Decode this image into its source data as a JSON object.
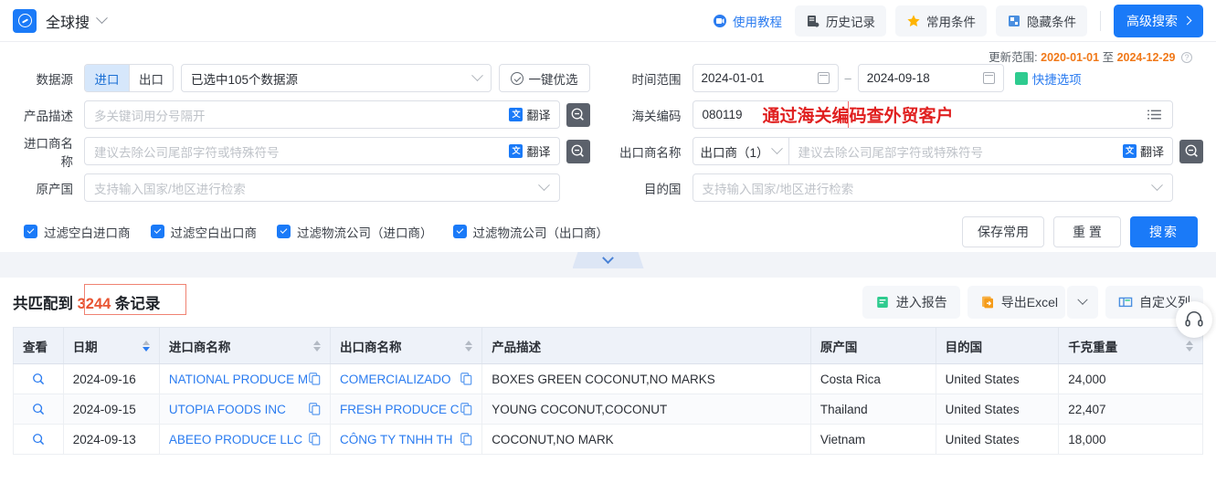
{
  "header": {
    "brand": "全球搜",
    "links": [
      {
        "label": "使用教程",
        "icon": "video-tutorial-icon",
        "style": "link"
      },
      {
        "label": "历史记录",
        "icon": "history-icon",
        "style": "chip"
      },
      {
        "label": "常用条件",
        "icon": "star-icon",
        "style": "chip"
      },
      {
        "label": "隐藏条件",
        "icon": "hide-icon",
        "style": "chip"
      }
    ],
    "advanced_button": "高级搜索"
  },
  "update_range": {
    "prefix": "更新范围:",
    "start": "2020-01-01",
    "connector": "至",
    "end": "2024-12-29"
  },
  "search_form": {
    "data_source": {
      "label": "数据源",
      "segments": [
        {
          "label": "进口",
          "active": true
        },
        {
          "label": "出口",
          "active": false
        }
      ],
      "selected_text": "已选中105个数据源",
      "optimize_button": "一键优选"
    },
    "product_desc": {
      "label": "产品描述",
      "placeholder": "多关键词用分号隔开",
      "value": "",
      "translate": "翻译"
    },
    "importer_name": {
      "label": "进口商名称",
      "placeholder": "建议去除公司尾部字符或特殊符号",
      "value": "",
      "translate": "翻译"
    },
    "origin_country": {
      "label": "原产国",
      "placeholder": "支持输入国家/地区进行检索",
      "value": ""
    },
    "time_range": {
      "label": "时间范围",
      "start": "2024-01-01",
      "end": "2024-09-18",
      "quick_options": "快捷选项"
    },
    "hs_code": {
      "label": "海关编码",
      "value": "080119",
      "annotation": "通过海关编码查外贸客户"
    },
    "exporter_name": {
      "label": "出口商名称",
      "sub_select": "出口商（1）",
      "placeholder": "建议去除公司尾部字符或特殊符号",
      "value": "",
      "translate": "翻译"
    },
    "dest_country": {
      "label": "目的国",
      "placeholder": "支持输入国家/地区进行检索",
      "value": ""
    }
  },
  "filters": [
    {
      "label": "过滤空白进口商",
      "checked": true
    },
    {
      "label": "过滤空白出口商",
      "checked": true
    },
    {
      "label": "过滤物流公司（进口商）",
      "checked": true
    },
    {
      "label": "过滤物流公司（出口商）",
      "checked": true
    }
  ],
  "form_actions": {
    "save": "保存常用",
    "reset": "重 置",
    "search": "搜索"
  },
  "results": {
    "count_prefix": "共匹配到",
    "count": "3244",
    "count_suffix": "条记录",
    "actions": {
      "report": "进入报告",
      "export": "导出Excel",
      "custom_columns": "自定义列"
    }
  },
  "table": {
    "columns": [
      {
        "label": "查看",
        "sortable": false
      },
      {
        "label": "日期",
        "sortable": true,
        "sorted": "desc"
      },
      {
        "label": "进口商名称",
        "sortable": true
      },
      {
        "label": "出口商名称",
        "sortable": true
      },
      {
        "label": "产品描述",
        "sortable": false
      },
      {
        "label": "原产国",
        "sortable": false
      },
      {
        "label": "目的国",
        "sortable": false
      },
      {
        "label": "千克重量",
        "sortable": true
      }
    ],
    "rows": [
      {
        "date": "2024-09-16",
        "importer": "NATIONAL PRODUCE M",
        "exporter": "COMERCIALIZADO",
        "product": "BOXES GREEN COCONUT,NO MARKS",
        "origin": "Costa Rica",
        "destination": "United States",
        "weight": "24,000"
      },
      {
        "date": "2024-09-15",
        "importer": "UTOPIA FOODS INC",
        "exporter": "FRESH PRODUCE C",
        "product": "YOUNG COCONUT,COCONUT",
        "origin": "Thailand",
        "destination": "United States",
        "weight": "22,407"
      },
      {
        "date": "2024-09-13",
        "importer": "ABEEO PRODUCE LLC",
        "exporter": "CÔNG TY TNHH TH",
        "product": "COCONUT,NO MARK",
        "origin": "Vietnam",
        "destination": "United States",
        "weight": "18,000"
      }
    ]
  },
  "colors": {
    "primary": "#1a7af8",
    "link": "#2b7cf0",
    "accent_orange": "#f07818",
    "highlight_red": "#e02020",
    "count_red": "#e85432"
  }
}
